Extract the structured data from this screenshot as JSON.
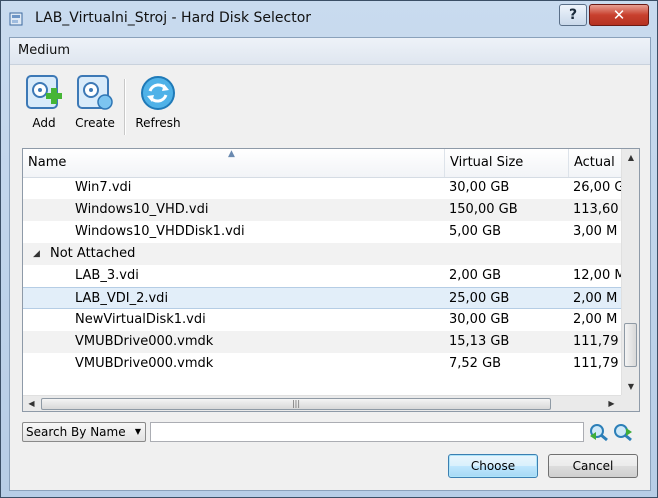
{
  "window": {
    "title": "LAB_Virtualni_Stroj - Hard Disk Selector",
    "help_label": "?",
    "close_label": "✕"
  },
  "menu": {
    "medium": "Medium"
  },
  "toolbar": {
    "add": "Add",
    "create": "Create",
    "refresh": "Refresh"
  },
  "table": {
    "columns": {
      "name": "Name",
      "virtual_size": "Virtual Size",
      "actual": "Actual"
    },
    "rows": [
      {
        "name": "Win7.vdi",
        "size": "30,00 GB",
        "actual": "26,00 G"
      },
      {
        "name": "Windows10_VHD.vdi",
        "size": "150,00 GB",
        "actual": "113,60"
      },
      {
        "name": "Windows10_VHDDisk1.vdi",
        "size": "5,00 GB",
        "actual": "3,00 M"
      },
      {
        "group": "Not Attached"
      },
      {
        "name": "LAB_3.vdi",
        "size": "2,00 GB",
        "actual": "12,00 M"
      },
      {
        "name": "LAB_VDI_2.vdi",
        "size": "25,00 GB",
        "actual": "2,00 M",
        "selected": true
      },
      {
        "name": "NewVirtualDisk1.vdi",
        "size": "30,00 GB",
        "actual": "2,00 M"
      },
      {
        "name": "VMUBDrive000.vmdk",
        "size": "15,13 GB",
        "actual": "111,79"
      },
      {
        "name": "VMUBDrive000.vmdk",
        "size": "7,52 GB",
        "actual": "111,79"
      }
    ]
  },
  "search": {
    "mode": "Search By Name",
    "value": ""
  },
  "buttons": {
    "choose": "Choose",
    "cancel": "Cancel"
  },
  "colors": {
    "selection": "#e2eef9",
    "titlebar": "#c9dbef",
    "close": "#c8402e"
  }
}
